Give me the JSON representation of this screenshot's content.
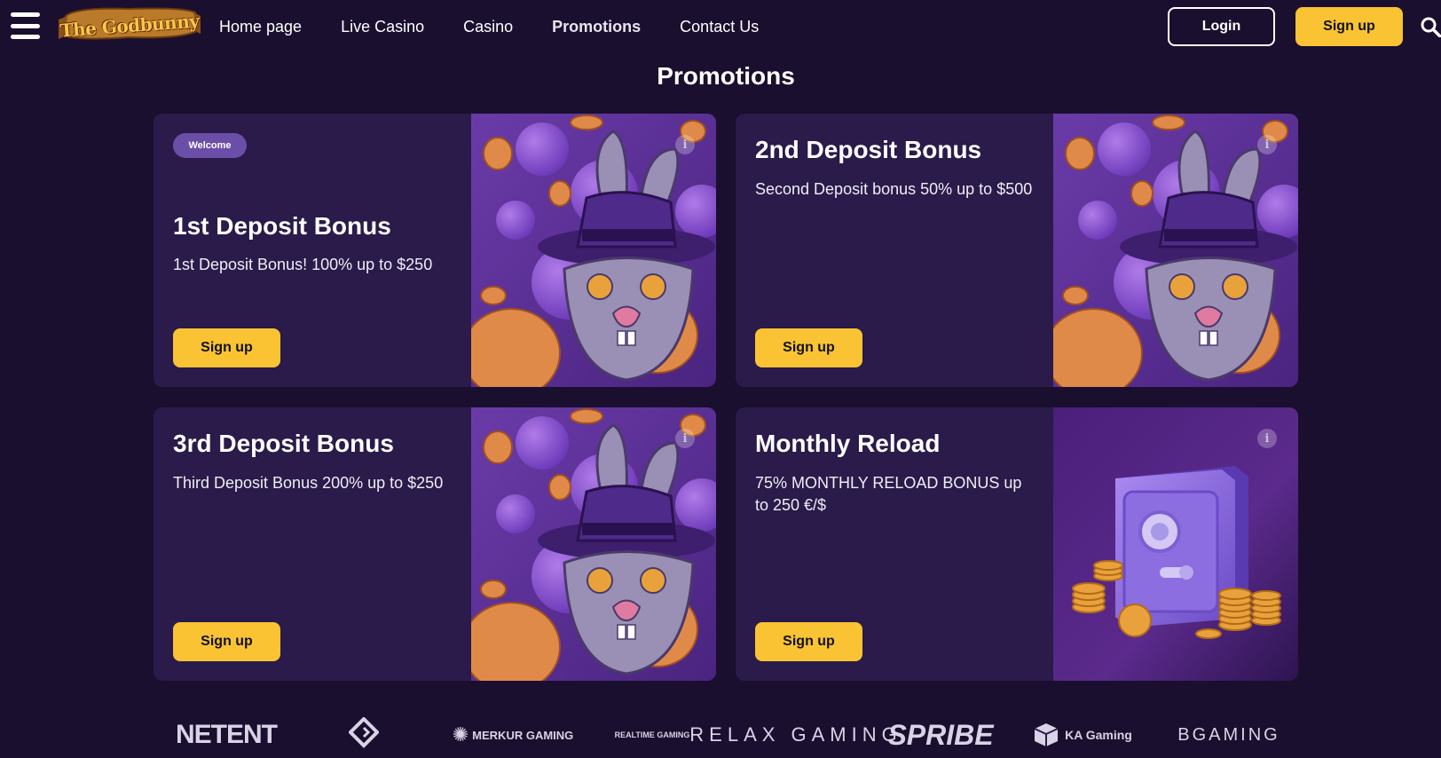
{
  "header": {
    "logo_text": "The Godbunny",
    "nav": [
      {
        "label": "Home page",
        "active": false
      },
      {
        "label": "Live Casino",
        "active": false
      },
      {
        "label": "Casino",
        "active": false
      },
      {
        "label": "Promotions",
        "active": true
      },
      {
        "label": "Contact Us",
        "active": false
      }
    ],
    "login_label": "Login",
    "signup_label": "Sign up",
    "icons": [
      "hamburger-menu-icon",
      "search-icon"
    ]
  },
  "page_title": "Promotions",
  "promotions": [
    {
      "badge": "Welcome",
      "title": "1st Deposit Bonus",
      "description": "1st Deposit Bonus! 100% up to $250",
      "button": "Sign up",
      "art": "bunny"
    },
    {
      "badge": "",
      "title": "2nd Deposit Bonus",
      "description": "Second Deposit bonus 50% up to $500",
      "button": "Sign up",
      "art": "bunny"
    },
    {
      "badge": "",
      "title": "3rd Deposit Bonus",
      "description": "Third Deposit Bonus 200% up to $250",
      "button": "Sign up",
      "art": "bunny"
    },
    {
      "badge": "",
      "title": "Monthly Reload",
      "description": "75% MONTHLY RELOAD BONUS up to 250 €/$",
      "button": "Sign up",
      "art": "safe"
    }
  ],
  "providers": [
    "NETENT",
    "G GAMES",
    "MERKUR GAMING",
    "REALTIME GAMING",
    "RELAX GAMING",
    "SPRIBE",
    "KA Gaming",
    "BGAMING"
  ],
  "colors": {
    "background": "#1a0f2e",
    "card": "#2a1b4a",
    "accent_yellow": "#f9c333",
    "badge_purple": "#6b4ea8"
  }
}
